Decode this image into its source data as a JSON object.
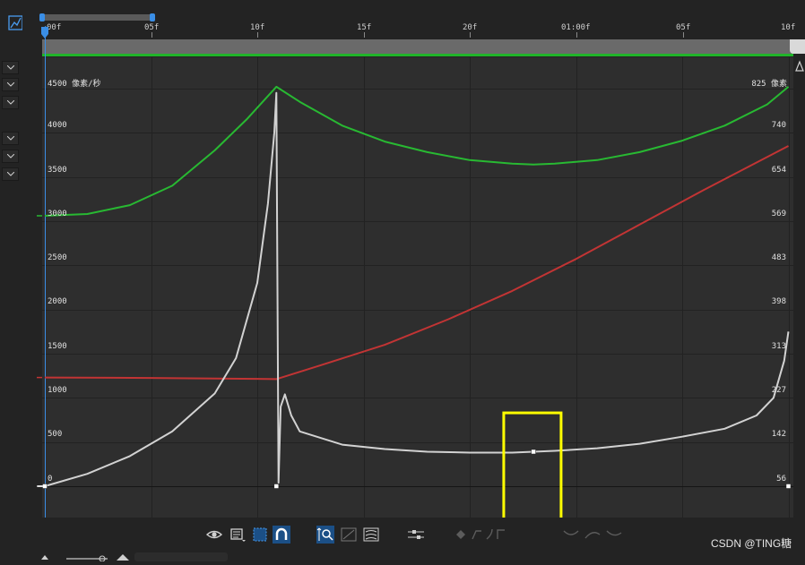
{
  "ruler": {
    "ticks": [
      "00f",
      "05f",
      "10f",
      "15f",
      "20f",
      "01:00f",
      "05f",
      "10f"
    ]
  },
  "graph": {
    "left_unit_label": "4500 像素/秒",
    "right_unit_label": "825 像素",
    "left_axis_labels": [
      "4000",
      "3500",
      "3000",
      "2500",
      "2000",
      "1500",
      "1000",
      "500",
      "0"
    ],
    "right_axis_labels": [
      "740",
      "654",
      "569",
      "483",
      "398",
      "313",
      "227",
      "142",
      "56"
    ]
  },
  "chart_data": {
    "type": "line",
    "x_unit": "frames",
    "x_ticks": [
      "00f",
      "05f",
      "10f",
      "15f",
      "20f",
      "01:00f",
      "05f",
      "10f"
    ],
    "x_tick_frames": [
      0,
      5,
      10,
      15,
      20,
      25,
      30,
      35
    ],
    "y_left_range": [
      0,
      4500
    ],
    "y_right_range": [
      56,
      825
    ],
    "grid": true,
    "series": [
      {
        "color": "#28b932",
        "x": [
          0,
          2,
          4,
          6,
          8,
          9.5,
          10.9,
          12,
          14,
          16,
          18,
          20,
          22,
          23,
          24,
          26,
          28,
          30,
          32,
          34,
          35
        ],
        "y": [
          3060,
          3080,
          3180,
          3400,
          3800,
          4150,
          4520,
          4350,
          4080,
          3900,
          3780,
          3690,
          3650,
          3640,
          3650,
          3690,
          3780,
          3910,
          4080,
          4320,
          4520
        ]
      },
      {
        "color": "#c23434",
        "x": [
          0,
          5,
          10,
          10.9,
          13,
          16,
          19,
          22,
          25,
          28,
          31,
          35
        ],
        "y": [
          1230,
          1225,
          1215,
          1212,
          1370,
          1600,
          1890,
          2210,
          2570,
          2960,
          3350,
          3850
        ]
      },
      {
        "color": "#d2d2d2",
        "x": [
          0,
          2,
          4,
          6,
          8,
          9,
          10,
          10.5,
          10.8,
          10.9,
          11.0,
          11.1,
          11.3,
          11.6,
          12,
          14,
          16,
          18,
          20,
          22,
          23,
          24,
          26,
          28,
          30,
          32,
          33.5,
          34.3,
          34.8,
          35
        ],
        "y": [
          0,
          140,
          340,
          620,
          1050,
          1450,
          2300,
          3200,
          4000,
          4450,
          40,
          900,
          1040,
          800,
          620,
          470,
          420,
          390,
          380,
          380,
          390,
          400,
          430,
          480,
          560,
          650,
          800,
          1000,
          1420,
          1750
        ]
      }
    ],
    "keyframes": [
      {
        "x": 0,
        "y": 0
      },
      {
        "x": 10.9,
        "y": 0
      },
      {
        "x": 23,
        "y": 390
      },
      {
        "x": 35,
        "y": 0
      }
    ],
    "annotation": {
      "type": "highlight-box",
      "color": "#ffff00",
      "x_range": [
        21.6,
        24.3
      ],
      "y_range": [
        -370,
        830
      ]
    }
  },
  "watermark": "CSDN @TING糖"
}
